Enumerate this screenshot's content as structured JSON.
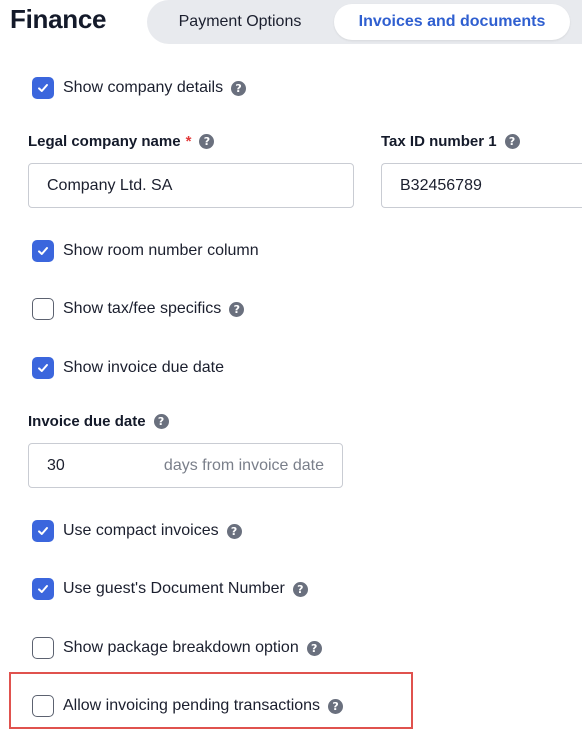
{
  "header": {
    "title": "Finance",
    "tabs": [
      {
        "label": "Payment Options",
        "active": false
      },
      {
        "label": "Invoices and documents",
        "active": true
      }
    ]
  },
  "colors": {
    "accent": "#3b66dd",
    "active_tab_text": "#2f5fd0",
    "required": "#e23a3a",
    "highlight_border": "#e0524e"
  },
  "icons": {
    "checkbox_checked": "check-icon",
    "help": "question-circle-icon"
  },
  "settings": {
    "show_company_details": {
      "label": "Show company details",
      "checked": true
    },
    "show_room_number": {
      "label": "Show room number column",
      "checked": true
    },
    "show_tax_fee": {
      "label": "Show tax/fee specifics",
      "checked": false
    },
    "show_due_date": {
      "label": "Show invoice due date",
      "checked": true
    },
    "compact_invoices": {
      "label": "Use compact invoices",
      "checked": true
    },
    "guest_doc_number": {
      "label": "Use guest's Document Number",
      "checked": true
    },
    "package_breakdown": {
      "label": "Show package breakdown option",
      "checked": false
    },
    "pending_transactions": {
      "label": "Allow invoicing pending transactions",
      "checked": false
    }
  },
  "fields": {
    "legal_company_name": {
      "label": "Legal company name",
      "required_mark": "*",
      "value": "Company Ltd. SA"
    },
    "tax_id_1": {
      "label": "Tax ID number 1",
      "value": "B32456789"
    },
    "invoice_due_date": {
      "label": "Invoice due date",
      "value": "30",
      "suffix": "days from invoice date"
    }
  }
}
